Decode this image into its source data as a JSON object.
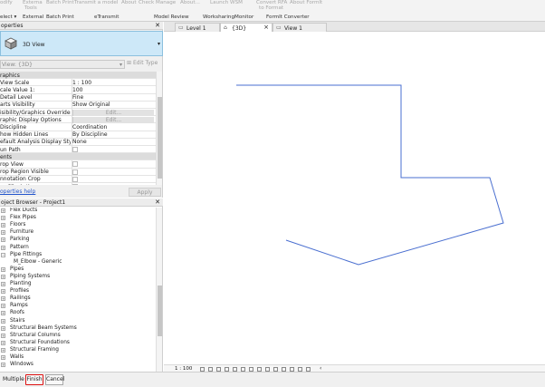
{
  "ribbon": {
    "dim_items": [
      "odify",
      "Externa\nTools",
      "Batch Print",
      "Transmit a model",
      "About",
      "Check",
      "Manage",
      "About...",
      "Launch WSM",
      "Convert RFA\nto Format",
      "About FormIt"
    ],
    "external_tools": "Externa",
    "external_tools_2": "Tools",
    "modify": "odify",
    "batch_print_btn": "Batch Print",
    "transmit": "Transmit a model",
    "about1": "About",
    "check": "Check",
    "manage": "Manage",
    "about2": "About...",
    "launch_wsm": "Launch WSM",
    "convert_rfa": "Convert RFA",
    "convert_rfa_2": "to Format",
    "about_formit": "About FormIt",
    "groups": {
      "select": "elect ▾",
      "external": "External",
      "batch_print": "Batch Print",
      "etransmit": "eTransmit",
      "model_review": "Model Review",
      "worksharing": "WorksharingMonitor",
      "formit": "FormIt Converter"
    }
  },
  "properties": {
    "title": "operties",
    "close": "✕",
    "type_name": "3D View",
    "filter": "View: {3D}",
    "edit_type": "Edit Type",
    "rows": [
      {
        "k": "raphics",
        "v": "",
        "section": true
      },
      {
        "k": "View Scale",
        "v": "1 : 100"
      },
      {
        "k": "cale Value    1:",
        "v": "100"
      },
      {
        "k": "Detail Level",
        "v": "Fine"
      },
      {
        "k": "arts Visibility",
        "v": "Show Original"
      },
      {
        "k": "isibility/Graphics Overrides",
        "v": "Edit...",
        "btn": true
      },
      {
        "k": "raphic Display Options",
        "v": "Edit...",
        "btn": true
      },
      {
        "k": "Discipline",
        "v": "Coordination"
      },
      {
        "k": "how Hidden Lines",
        "v": "By Discipline"
      },
      {
        "k": "efault Analysis Display Style",
        "v": "None"
      },
      {
        "k": "un Path",
        "v": "",
        "check": true
      },
      {
        "k": "ents",
        "v": "",
        "section": true
      },
      {
        "k": "rop View",
        "v": "",
        "check": true
      },
      {
        "k": "rop Region Visible",
        "v": "",
        "check": true
      },
      {
        "k": "nnotation Crop",
        "v": "",
        "check": true
      },
      {
        "k": "ar Clip Active",
        "v": "",
        "check": true
      }
    ],
    "help": "operties help",
    "apply": "Apply"
  },
  "browser": {
    "title": "oject Browser - Project1",
    "close": "✕",
    "items": [
      {
        "label": "Flex Ducts",
        "child": false
      },
      {
        "label": "Flex Pipes",
        "child": false
      },
      {
        "label": "Floors",
        "child": false
      },
      {
        "label": "Furniture",
        "child": false
      },
      {
        "label": "Parking",
        "child": false
      },
      {
        "label": "Pattern",
        "child": false
      },
      {
        "label": "Pipe Fittings",
        "child": false,
        "open": true
      },
      {
        "label": "M_Elbow - Generic",
        "child": true
      },
      {
        "label": "Pipes",
        "child": false
      },
      {
        "label": "Piping Systems",
        "child": false
      },
      {
        "label": "Planting",
        "child": false
      },
      {
        "label": "Profiles",
        "child": false
      },
      {
        "label": "Railings",
        "child": false
      },
      {
        "label": "Ramps",
        "child": false
      },
      {
        "label": "Roofs",
        "child": false
      },
      {
        "label": "Stairs",
        "child": false
      },
      {
        "label": "Structural Beam Systems",
        "child": false
      },
      {
        "label": "Structural Columns",
        "child": false
      },
      {
        "label": "Structural Foundations",
        "child": false
      },
      {
        "label": "Structural Framing",
        "child": false
      },
      {
        "label": "Walls",
        "child": false
      },
      {
        "label": "Windows",
        "child": false
      }
    ]
  },
  "bottom": {
    "multiple": "Multiple",
    "finish": "Finish",
    "cancel": "Cancel"
  },
  "tabs": [
    {
      "label": "Level 1",
      "active": false,
      "icon": "floorplan-icon"
    },
    {
      "label": "{3D}",
      "active": true,
      "icon": "house-3d-icon"
    },
    {
      "label": "View 1",
      "active": false,
      "icon": "view-icon"
    }
  ],
  "view": {
    "scale": "1 : 100",
    "scroll_arrow": "‹",
    "line_color": "#4a6fd0"
  }
}
